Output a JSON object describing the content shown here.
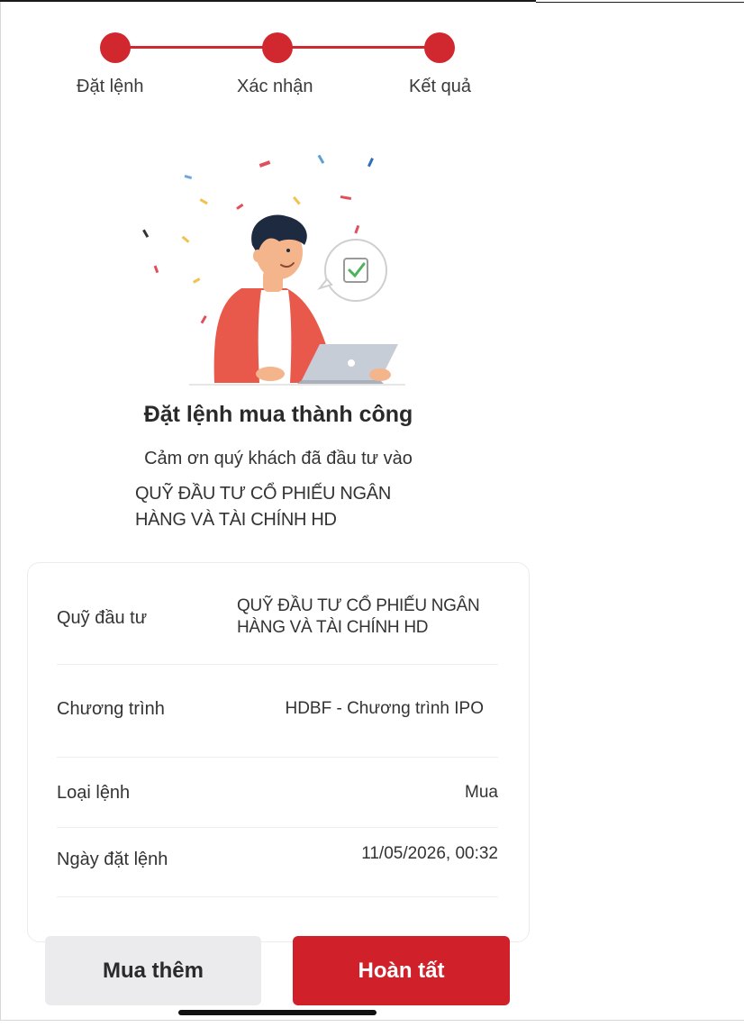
{
  "stepper": {
    "steps": [
      {
        "label": "Đặt lệnh"
      },
      {
        "label": "Xác nhận"
      },
      {
        "label": "Kết quả"
      }
    ],
    "accent_color": "#d0282e"
  },
  "result": {
    "title": "Đặt lệnh mua thành công",
    "subtitle": "Cảm ơn quý khách đã đầu tư vào",
    "fund_line1": "QUỸ ĐẦU TƯ CỔ PHIẾU NGÂN",
    "fund_line2": "HÀNG VÀ TÀI CHÍNH HD"
  },
  "details": {
    "fund": {
      "label": "Quỹ đầu tư",
      "value_line1": "QUỸ ĐẦU TƯ CỔ PHIẾU NGÂN",
      "value_line2": "HÀNG VÀ TÀI CHÍNH HD"
    },
    "program": {
      "label": "Chương trình",
      "value": "HDBF - Chương trình IPO"
    },
    "order_type": {
      "label": "Loại lệnh",
      "value": "Mua"
    },
    "order_date": {
      "label": "Ngày đặt lệnh",
      "value": "11/05/2026, 00:32"
    }
  },
  "actions": {
    "buy_more_label": "Mua thêm",
    "done_label": "Hoàn tất"
  },
  "icons": {
    "success_illustration": "person-laptop-success-icon",
    "checkmark": "check-icon"
  }
}
